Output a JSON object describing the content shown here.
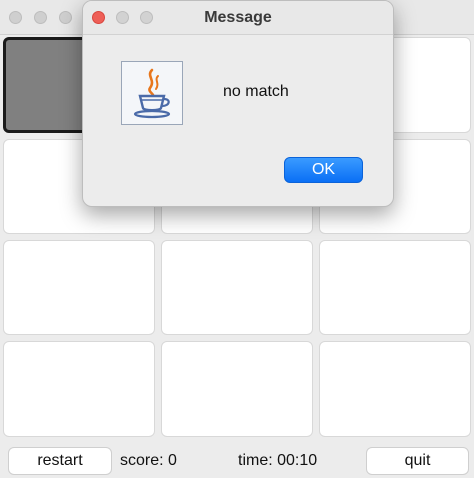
{
  "game": {
    "restart_label": "restart",
    "quit_label": "quit",
    "score_text": "score: 0",
    "time_text": "time: 00:10"
  },
  "dialog": {
    "title": "Message",
    "message": "no match",
    "ok_label": "OK",
    "icon": "java-coffee-cup-icon"
  },
  "colors": {
    "ok_button": "#0a6ff5",
    "close_dot": "#ee5f57",
    "revealed_card": "#808080"
  }
}
